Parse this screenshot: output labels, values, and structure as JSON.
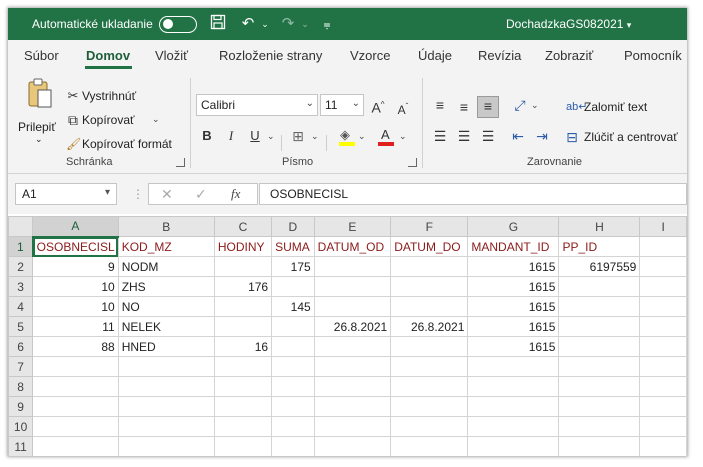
{
  "titlebar": {
    "autosave_label": "Automatické ukladanie",
    "filename": "DochadzkaGS082021",
    "accent_color": "#217346"
  },
  "tabs": [
    "Súbor",
    "Domov",
    "Vložiť",
    "Rozloženie strany",
    "Vzorce",
    "Údaje",
    "Revízia",
    "Zobraziť",
    "Pomocník"
  ],
  "active_tab": "Domov",
  "ribbon": {
    "clipboard": {
      "paste": "Prilepiť",
      "cut": "Vystrihnúť",
      "copy": "Kopírovať",
      "format_painter": "Kopírovať formát",
      "group": "Schránka"
    },
    "font": {
      "font_name": "Calibri",
      "font_size": "11",
      "group": "Písmo"
    },
    "alignment": {
      "wrap_text": "Zalomiť text",
      "merge_center": "Zlúčiť a centrovať",
      "group": "Zarovnanie"
    }
  },
  "formula_bar": {
    "name_box": "A1",
    "fx": "fx",
    "formula": "OSOBNECISL"
  },
  "sheet": {
    "columns": [
      "A",
      "B",
      "C",
      "D",
      "E",
      "F",
      "G",
      "H",
      "I"
    ],
    "rows": [
      [
        "OSOBNECISL",
        "KOD_MZ",
        "HODINY",
        "SUMA",
        "DATUM_OD",
        "DATUM_DO",
        "MANDANT_ID",
        "PP_ID",
        ""
      ],
      [
        "9",
        "NODM",
        "",
        "175",
        "",
        "",
        "1615",
        "6197559",
        ""
      ],
      [
        "10",
        "ZHS",
        "176",
        "",
        "",
        "",
        "1615",
        "",
        ""
      ],
      [
        "10",
        "NO",
        "",
        "145",
        "",
        "",
        "1615",
        "",
        ""
      ],
      [
        "11",
        "NELEK",
        "",
        "",
        "26.8.2021",
        "26.8.2021",
        "1615",
        "",
        ""
      ],
      [
        "88",
        "HNED",
        "16",
        "",
        "",
        "",
        "1615",
        "",
        ""
      ],
      [
        "",
        "",
        "",
        "",
        "",
        "",
        "",
        "",
        ""
      ],
      [
        "",
        "",
        "",
        "",
        "",
        "",
        "",
        "",
        ""
      ],
      [
        "",
        "",
        "",
        "",
        "",
        "",
        "",
        "",
        ""
      ],
      [
        "",
        "",
        "",
        "",
        "",
        "",
        "",
        "",
        ""
      ],
      [
        "",
        "",
        "",
        "",
        "",
        "",
        "",
        "",
        ""
      ]
    ],
    "row_numbers": [
      "1",
      "2",
      "3",
      "4",
      "5",
      "6",
      "7",
      "8",
      "9",
      "10",
      "11"
    ]
  }
}
